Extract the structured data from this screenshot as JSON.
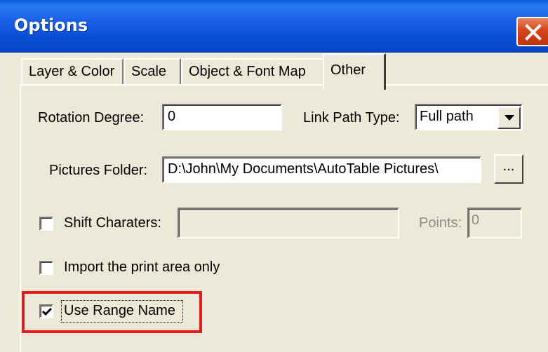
{
  "window": {
    "title": "Options"
  },
  "tabs": [
    {
      "label": "Layer & Color",
      "active": false
    },
    {
      "label": "Scale",
      "active": false
    },
    {
      "label": "Object & Font Map",
      "active": false
    },
    {
      "label": "Other",
      "active": true
    }
  ],
  "form": {
    "rotation_degree": {
      "label": "Rotation Degree:",
      "value": "0"
    },
    "link_path_type": {
      "label": "Link Path Type:",
      "value": "Full path"
    },
    "pictures_folder": {
      "label": "Pictures Folder:",
      "value": "D:\\John\\My Documents\\AutoTable Pictures\\",
      "browse_label": "..."
    },
    "shift_characters": {
      "label": "Shift Charaters:",
      "checked": false,
      "value": ""
    },
    "points": {
      "label": "Points:",
      "value": "0"
    },
    "import_print_area": {
      "label": "Import the print area only",
      "checked": false
    },
    "use_range_name": {
      "label": "Use Range Name",
      "checked": true
    }
  },
  "colors": {
    "titlebar": "#0a4fd6",
    "close_button": "#d4451c",
    "dialog_background": "#ece9d8",
    "highlight_annotation": "#e31b1b"
  }
}
